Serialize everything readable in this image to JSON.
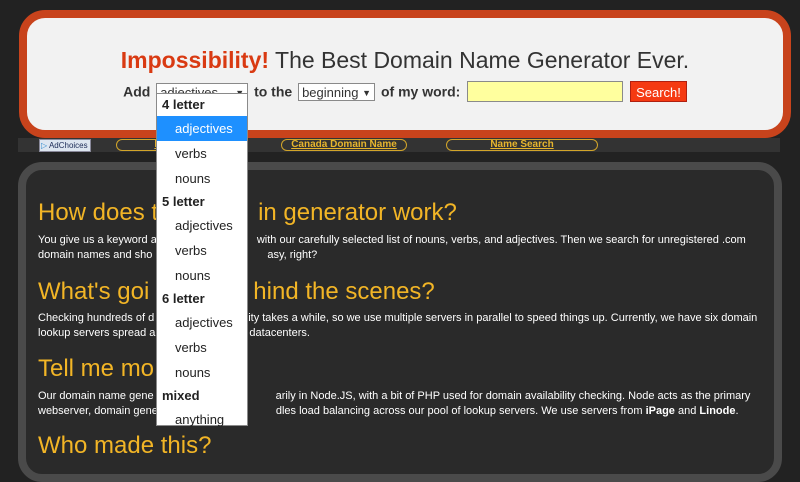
{
  "header": {
    "brand": "Impossibility!",
    "tagline": "The Best Domain Name Generator Ever.",
    "add_label": "Add",
    "type_select_value": "adjectives",
    "to_the_label": "to the",
    "position_select_value": "beginning",
    "of_my_word_label": "of my word:",
    "word_input_value": "",
    "search_button_label": "Search!"
  },
  "adbar": {
    "adchoices_label": "AdChoices",
    "links": [
      {
        "label": "N"
      },
      {
        "label": "Canada Domain Name"
      },
      {
        "label": "Name Search"
      }
    ]
  },
  "sections": [
    {
      "title": "How does t",
      "title_tail": "in generator work?",
      "text_a": "You give us a keyword a",
      "text_b": "with our carefully selected list of nouns, verbs, and adjectives. Then we search for unregistered .com",
      "text_c": "domain names and sho",
      "text_d": "asy, right?"
    },
    {
      "title": "What's goi",
      "title_tail": "hind the scenes?",
      "text_a": "Checking hundreds of d",
      "text_b": "ity takes a while, so we use multiple servers in parallel to speed things up. Currently, we have six domain",
      "text_c": "lookup servers spread a",
      "text_d": "datacenters."
    },
    {
      "title": "Tell me mo",
      "text_a": "Our domain name gene",
      "text_b": "arily in Node.JS, with a bit of PHP used for domain availability checking. Node acts as the primary",
      "text_c": "webserver, domain gene",
      "text_d": "dles load balancing across our pool of lookup servers. We use servers from",
      "text_e": "iPage",
      "text_f": "and",
      "text_g": "Linode",
      "text_h": "."
    },
    {
      "title": "Who made this?"
    }
  ],
  "dropdown": {
    "groups": [
      {
        "label": "4 letter",
        "options": [
          "adjectives",
          "verbs",
          "nouns"
        ]
      },
      {
        "label": "5 letter",
        "options": [
          "adjectives",
          "verbs",
          "nouns"
        ]
      },
      {
        "label": "6 letter",
        "options": [
          "adjectives",
          "verbs",
          "nouns"
        ]
      },
      {
        "label": "mixed",
        "options": [
          "anything"
        ]
      }
    ],
    "selected": "4 letter / adjectives"
  },
  "colors": {
    "accent": "#c8431c",
    "brand_text": "#d93a12",
    "section_title": "#f2b526",
    "selected_option": "#1e90ff",
    "input_bg": "#ffff9e"
  }
}
